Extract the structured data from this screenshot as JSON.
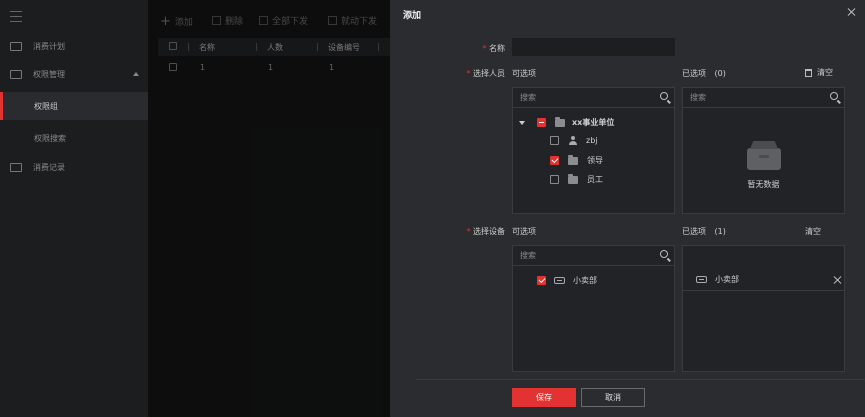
{
  "sidebar": {
    "items": [
      {
        "label": "消费计划"
      },
      {
        "label": "权限管理"
      },
      {
        "label": "权限组"
      },
      {
        "label": "权限搜索"
      },
      {
        "label": "消费记录"
      }
    ]
  },
  "toolbar": {
    "add": "添加",
    "delete": "删除",
    "issue_all": "全部下发",
    "sync": "就动下发"
  },
  "table": {
    "headers": [
      "名称",
      "人数",
      "设备编号"
    ],
    "rows": [
      [
        "1",
        "1",
        "1"
      ]
    ]
  },
  "dialog": {
    "title": "添加",
    "name_label": "名称",
    "name_value": "",
    "person_label": "选择人员",
    "device_label": "选择设备",
    "optional_label": "可选项",
    "selected_persons_label": "已选项",
    "selected_persons_count": "(0)",
    "selected_devices_label": "已选项",
    "selected_devices_count": "(1)",
    "clear_label": "清空",
    "search_placeholder": "搜索",
    "tree": {
      "root": "xx事业单位",
      "children": [
        "zbj",
        "领导",
        "员工"
      ]
    },
    "empty_text": "暂无数据",
    "devices_available": [
      "小卖部"
    ],
    "devices_selected": [
      "小卖部"
    ],
    "save_label": "保存",
    "cancel_label": "取消"
  },
  "colors": {
    "accent": "#e23232",
    "dialog_bg": "#2b2c2f",
    "panel_bg": "#222326"
  }
}
